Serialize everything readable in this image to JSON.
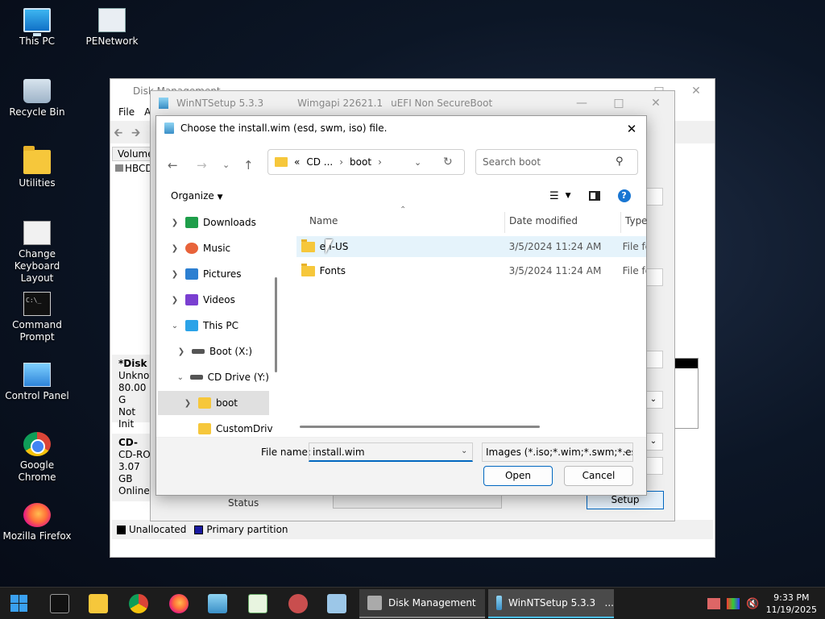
{
  "desktop": {
    "icons": [
      {
        "label": "This PC"
      },
      {
        "label": "PENetwork"
      },
      {
        "label": "Recycle Bin"
      },
      {
        "label": "Utilities"
      },
      {
        "label": "Change Keyboard Layout"
      },
      {
        "label": "Command Prompt"
      },
      {
        "label": "Control Panel"
      },
      {
        "label": "Google Chrome"
      },
      {
        "label": "Mozilla Firefox"
      }
    ]
  },
  "disk_management": {
    "title": "Disk Management",
    "menu": [
      "File",
      "A"
    ],
    "volume_header": "Volume",
    "volume_row": "HBCD",
    "disk0": {
      "name": "*Disk",
      "type": "Unknow",
      "size": "80.00 G",
      "status": "Not Init"
    },
    "disk1": {
      "name": "CD-",
      "type": "CD-RO",
      "size": "3.07 GB",
      "status": "Online"
    },
    "legend": [
      {
        "label": "Unallocated",
        "color": "#000000"
      },
      {
        "label": "Primary partition",
        "color": "#1a1aa0"
      }
    ]
  },
  "winntsetup": {
    "title": "WinNTSetup 5.3.3",
    "wimgapi": "Wimgapi 22621.1",
    "boot_mode": "uEFI Non SecureBoot",
    "status_label": "Status",
    "setup_label": "Setup"
  },
  "dialog": {
    "title": "Choose the install.wim (esd, swm, iso) file.",
    "address": {
      "prefix": "«",
      "crumbs": [
        "CD ...",
        "boot"
      ]
    },
    "search_placeholder": "Search boot",
    "organize_label": "Organize",
    "nav_items": [
      {
        "label": "Downloads",
        "icon": "download-icon",
        "color": "#1e9e4a"
      },
      {
        "label": "Music",
        "icon": "music-icon",
        "color": "#e8633a"
      },
      {
        "label": "Pictures",
        "icon": "pictures-icon",
        "color": "#2c7fd1"
      },
      {
        "label": "Videos",
        "icon": "videos-icon",
        "color": "#7a3fd1"
      },
      {
        "label": "This PC",
        "icon": "computer-icon",
        "color": "#2ba3e8"
      },
      {
        "label": "Boot (X:)",
        "icon": "drive-icon",
        "color": "#555555"
      },
      {
        "label": "CD Drive (Y:)",
        "icon": "cd-drive-icon",
        "color": "#555555"
      },
      {
        "label": "boot",
        "icon": "folder-icon",
        "color": "#f6c73b"
      },
      {
        "label": "CustomDriv",
        "icon": "folder-icon",
        "color": "#f6c73b"
      }
    ],
    "columns": {
      "name": "Name",
      "date": "Date modified",
      "type": "Type"
    },
    "files": [
      {
        "name": "en-US",
        "date": "3/5/2024 11:24 AM",
        "type": "File fo"
      },
      {
        "name": "Fonts",
        "date": "3/5/2024 11:24 AM",
        "type": "File fo"
      }
    ],
    "file_name_label": "File name:",
    "file_name_value": "install.wim",
    "file_type_value": "Images (*.iso;*.wim;*.swm;*.esd)",
    "open_label": "Open",
    "cancel_label": "Cancel"
  },
  "taskbar": {
    "tasks": [
      {
        "label": "Disk Management"
      },
      {
        "label": "WinNTSetup 5.3.3   ..."
      }
    ],
    "time": "9:33 PM",
    "date": "11/19/2025"
  }
}
